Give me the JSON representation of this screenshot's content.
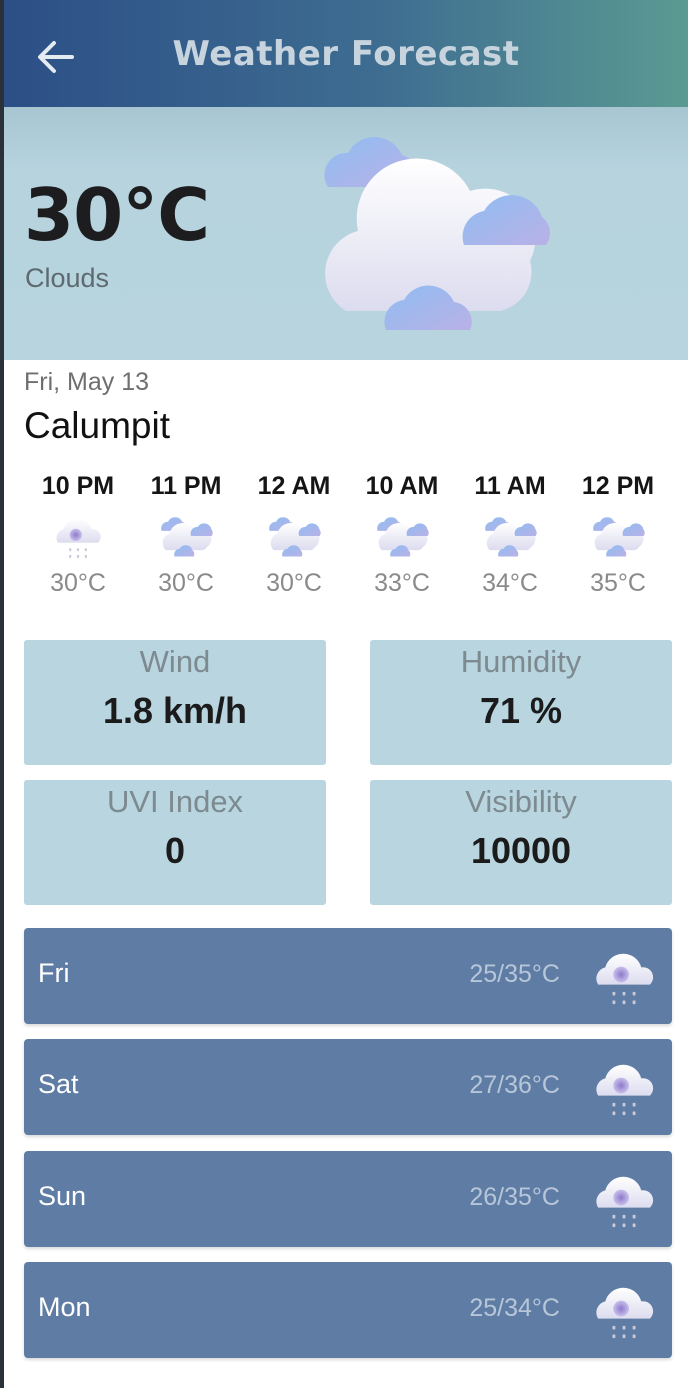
{
  "header": {
    "title": "Weather Forecast",
    "back_icon": "arrow-left-icon"
  },
  "current": {
    "temperature": "30°C",
    "description": "Clouds",
    "icon": "clouds-icon",
    "date": "Fri, May 13",
    "city": "Calumpit"
  },
  "hourly": [
    {
      "time": "10 PM",
      "temp": "30°C",
      "icon": "cloud-drizzle-icon"
    },
    {
      "time": "11 PM",
      "temp": "30°C",
      "icon": "clouds-icon"
    },
    {
      "time": "12 AM",
      "temp": "30°C",
      "icon": "clouds-icon"
    },
    {
      "time": "10 AM",
      "temp": "33°C",
      "icon": "clouds-icon"
    },
    {
      "time": "11 AM",
      "temp": "34°C",
      "icon": "clouds-icon"
    },
    {
      "time": "12 PM",
      "temp": "35°C",
      "icon": "clouds-icon"
    }
  ],
  "stats": {
    "wind": {
      "label": "Wind",
      "value": "1.8 km/h"
    },
    "humidity": {
      "label": "Humidity",
      "value": "71 %"
    },
    "uvi": {
      "label": "UVI Index",
      "value": "0"
    },
    "visibility": {
      "label": "Visibility",
      "value": "10000"
    }
  },
  "daily": [
    {
      "day": "Fri",
      "temp": "25/35°C",
      "icon": "cloud-drizzle-icon"
    },
    {
      "day": "Sat",
      "temp": "27/36°C",
      "icon": "cloud-drizzle-icon"
    },
    {
      "day": "Sun",
      "temp": "26/35°C",
      "icon": "cloud-drizzle-icon"
    },
    {
      "day": "Mon",
      "temp": "25/34°C",
      "icon": "cloud-drizzle-icon"
    }
  ],
  "colors": {
    "header_start": "#2c4f86",
    "header_end": "#5b9a92",
    "hero_bg": "#b7d4df",
    "stat_bg": "#b8d5e0",
    "day_row_bg": "#5e7ca4"
  }
}
